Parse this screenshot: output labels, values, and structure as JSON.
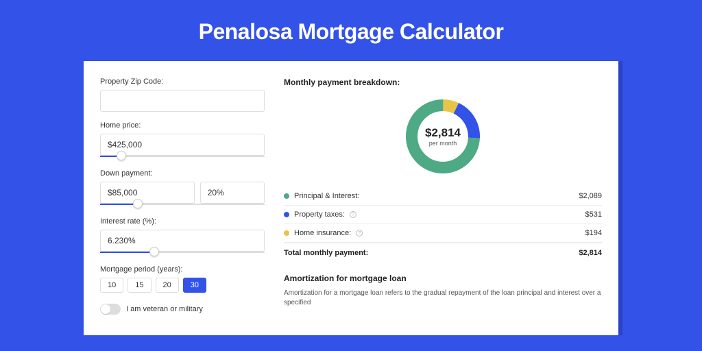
{
  "title": "Penalosa Mortgage Calculator",
  "form": {
    "zip_label": "Property Zip Code:",
    "zip_value": "",
    "home_price_label": "Home price:",
    "home_price_value": "$425,000",
    "down_payment_label": "Down payment:",
    "down_payment_value": "$85,000",
    "down_payment_pct": "20%",
    "interest_label": "Interest rate (%):",
    "interest_value": "6.230%",
    "period_label": "Mortgage period (years):",
    "periods": [
      "10",
      "15",
      "20",
      "30"
    ],
    "period_selected": "30",
    "veteran_label": "I am veteran or military"
  },
  "breakdown": {
    "title": "Monthly payment breakdown:",
    "center_amount": "$2,814",
    "center_sub": "per month",
    "rows": [
      {
        "label": "Principal & Interest:",
        "value": "$2,089"
      },
      {
        "label": "Property taxes:",
        "value": "$531"
      },
      {
        "label": "Home insurance:",
        "value": "$194"
      }
    ],
    "total_label": "Total monthly payment:",
    "total_value": "$2,814"
  },
  "amortization": {
    "title": "Amortization for mortgage loan",
    "text": "Amortization for a mortgage loan refers to the gradual repayment of the loan principal and interest over a specified"
  },
  "chart_data": {
    "type": "pie",
    "title": "Monthly payment breakdown",
    "series": [
      {
        "name": "Principal & Interest",
        "value": 2089,
        "color": "#4ea985"
      },
      {
        "name": "Property taxes",
        "value": 531,
        "color": "#3252e8"
      },
      {
        "name": "Home insurance",
        "value": 194,
        "color": "#e8c547"
      }
    ],
    "total": 2814,
    "center_label": "$2,814 per month"
  }
}
